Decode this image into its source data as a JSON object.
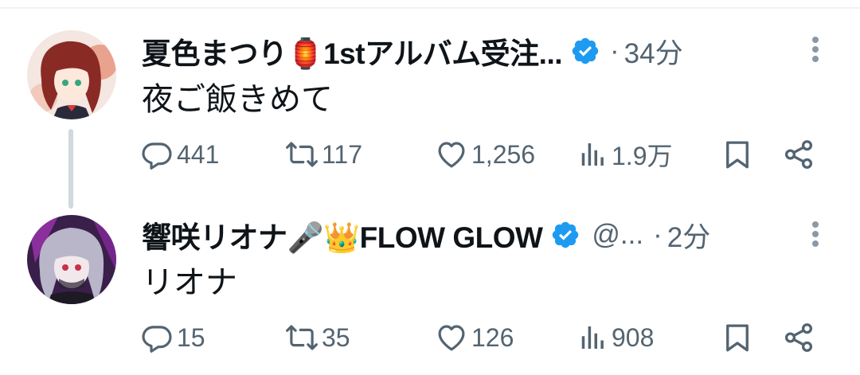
{
  "colors": {
    "text_primary": "#0f1419",
    "text_secondary": "#536471",
    "verified_blue": "#1d9bf0",
    "thread_line": "#cfd9de"
  },
  "tweets": [
    {
      "display_name": "夏色まつり🏮1stアルバム受注...",
      "handle": "",
      "separator": "·",
      "time": "34分",
      "text": "夜ご飯きめて",
      "verified": true,
      "actions": {
        "replies": "441",
        "retweets": "117",
        "likes": "1,256",
        "views": "1.9万"
      }
    },
    {
      "display_name": "響咲リオナ🎤👑FLOW GLOW",
      "handle": "@...",
      "separator": "·",
      "time": "2分",
      "text": "リオナ",
      "verified": true,
      "actions": {
        "replies": "15",
        "retweets": "35",
        "likes": "126",
        "views": "908"
      }
    }
  ],
  "icons": {
    "reply": "reply-icon",
    "retweet": "retweet-icon",
    "like": "heart-icon",
    "views": "views-chart-icon",
    "bookmark": "bookmark-icon",
    "share": "share-icon",
    "more": "more-vertical-icon",
    "verified": "verified-badge-icon"
  }
}
